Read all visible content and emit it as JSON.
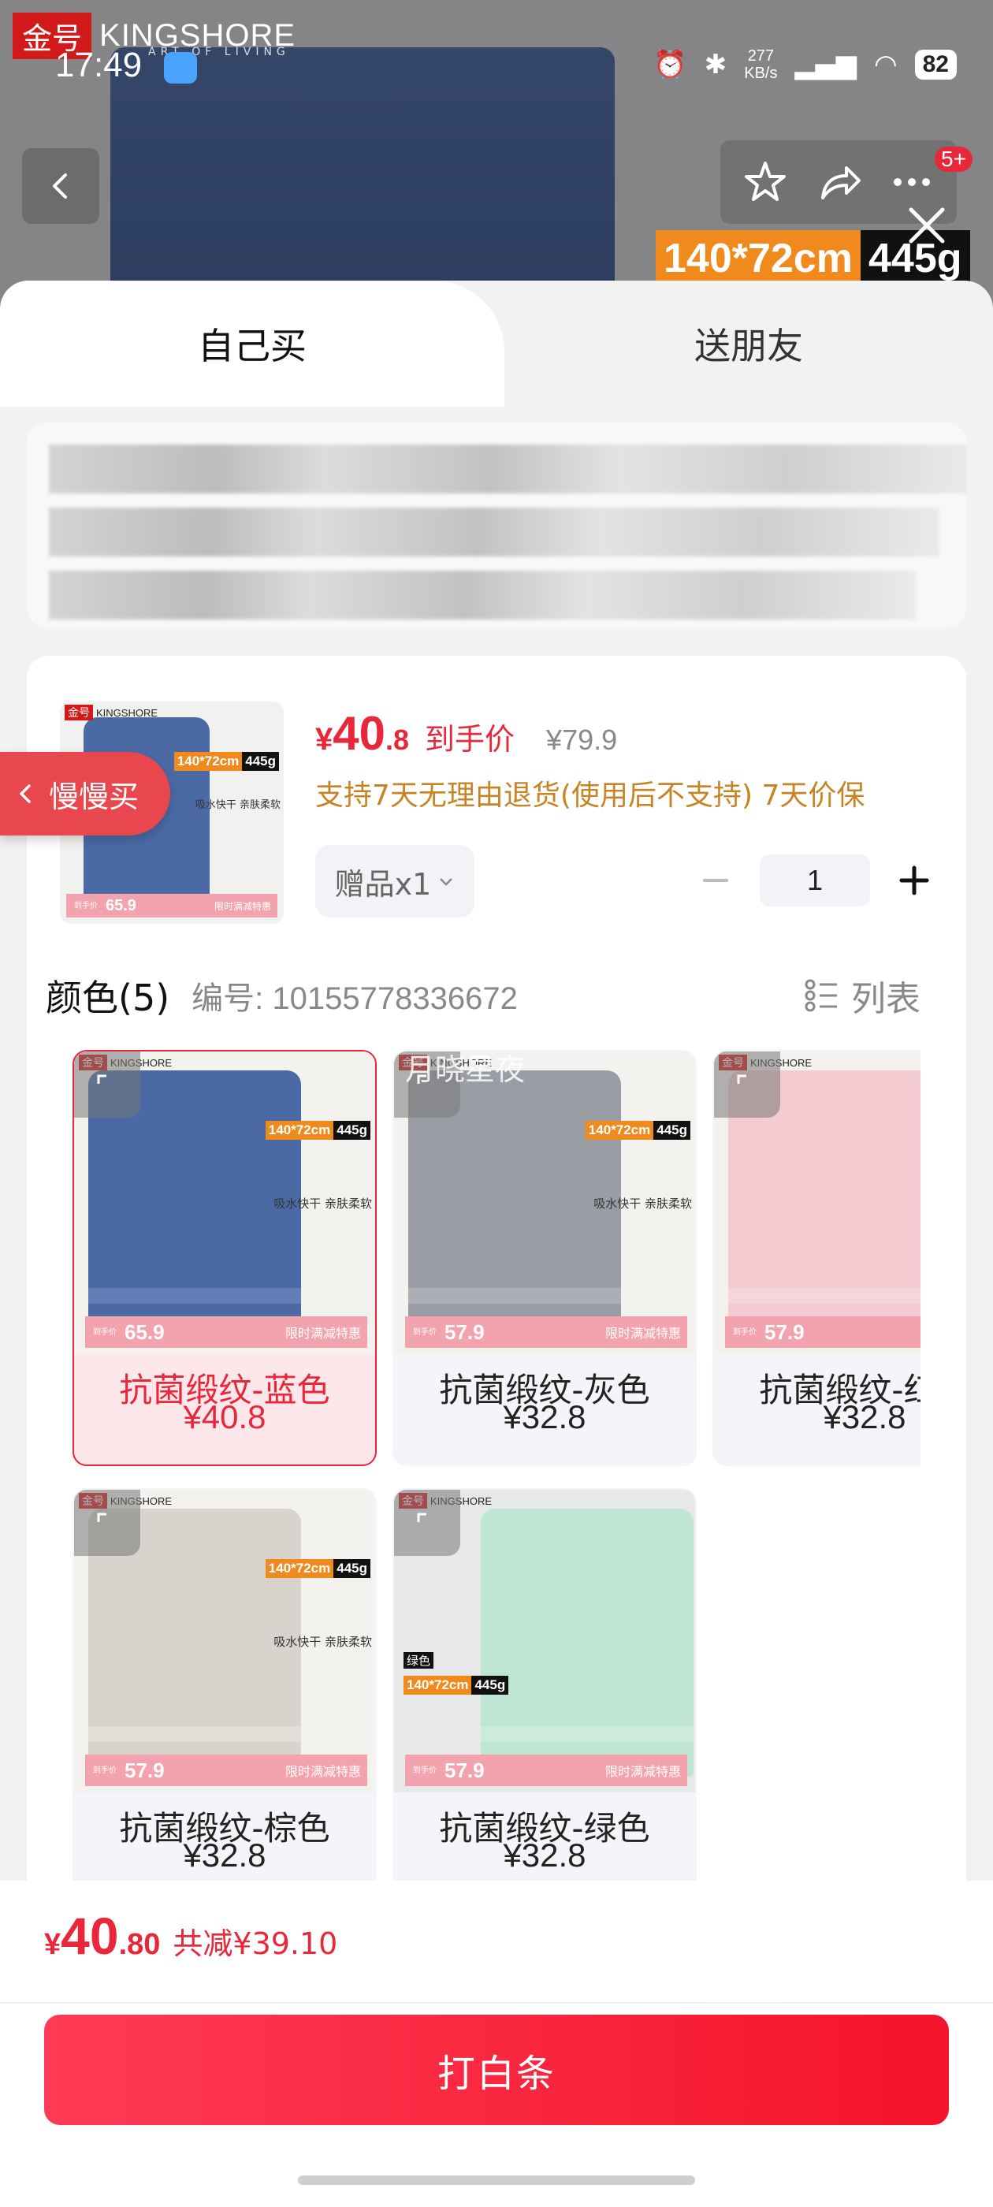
{
  "status": {
    "time": "17:49",
    "net_speed": "277\nKB/s",
    "battery": "82"
  },
  "banner": {
    "brand_badge": "金号",
    "brand_name": "KINGSHORE",
    "brand_sub": "ART OF LIVING",
    "size": "140*72cm",
    "weight": "445g",
    "cart_badge": "5+"
  },
  "tabs": {
    "own": "自己买",
    "friend": "送朋友"
  },
  "product": {
    "price_currency": "¥",
    "price_int": "40",
    "price_dec": ".8",
    "price_tag": "到手价",
    "original_price": "¥79.9",
    "return_policy": "支持7天无理由退货(使用后不支持)  7天价保",
    "gift": "赠品x1",
    "quantity": "1"
  },
  "slow_buy": "慢慢买",
  "color_section": {
    "title": "颜色(5)",
    "sku_no": "编号: 10155778336672",
    "list_label": "列表"
  },
  "variants": [
    {
      "name": "抗菌缎纹-蓝色",
      "price": "¥40.8",
      "promo_price": "65.9",
      "towel_color": "#4b6aa5",
      "selected": true
    },
    {
      "name": "抗菌缎纹-灰色",
      "price": "¥32.8",
      "promo_price": "57.9",
      "towel_color": "#9a9ea4",
      "selected": false
    },
    {
      "name": "抗菌缎纹-红色",
      "price": "¥32.8",
      "promo_price": "57.9",
      "towel_color": "#f3cbd1",
      "selected": false
    },
    {
      "name": "抗菌缎纹-棕色",
      "price": "¥32.8",
      "promo_price": "57.9",
      "towel_color": "#d8d3cc",
      "selected": false
    },
    {
      "name": "抗菌缎纹-绿色",
      "price": "¥32.8",
      "promo_price": "57.9",
      "towel_color": "#bfe6d4",
      "selected": false
    }
  ],
  "promo": {
    "label": "到手价",
    "right_text": "限时满减特惠",
    "feature": "吸水快干 亲肤柔软",
    "green_extra": "绿色"
  },
  "watermark": "月晓星夜",
  "bottom": {
    "total_currency": "¥",
    "total_int": "40",
    "total_dec": ".80",
    "savings": "共减¥39.10",
    "pay_button": "打白条"
  },
  "colors": {
    "accent": "#e8283a",
    "gold": "#c88424"
  }
}
